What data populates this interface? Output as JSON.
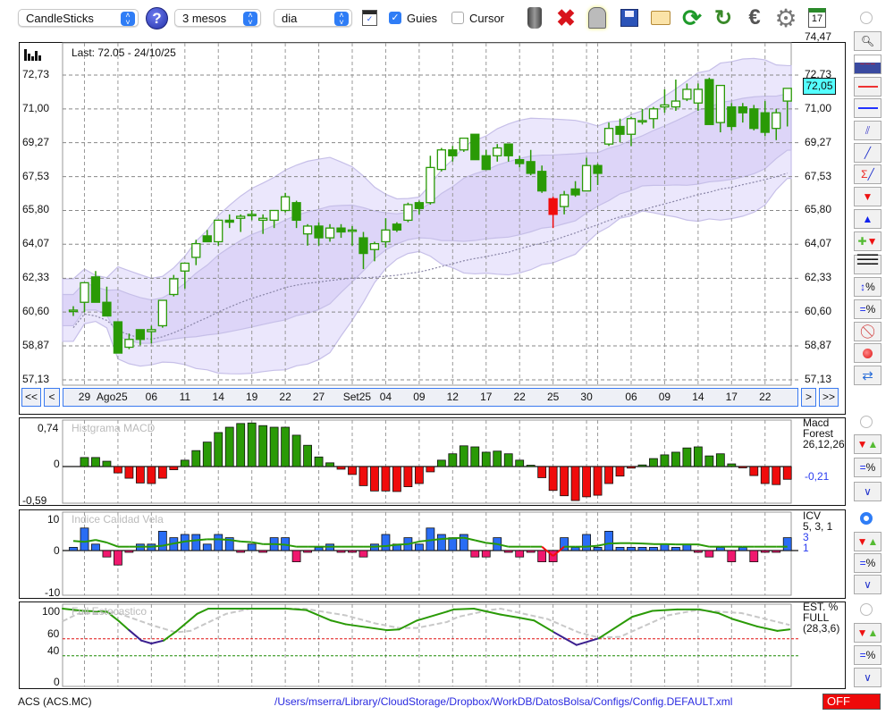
{
  "toolbar": {
    "chart_type": "CandleSticks",
    "period": "3 mesos",
    "interval": "dia",
    "guides_label": "Guies",
    "guides_checked": true,
    "cursor_label": "Cursor",
    "cursor_checked": false,
    "help": "?",
    "icons": [
      "trash-icon",
      "delete-icon",
      "lamp-icon",
      "save-icon",
      "folder-icon",
      "refresh-icon",
      "reload-icon",
      "euro-icon",
      "gear-icon",
      "calendar-icon"
    ],
    "calendar_day": "17"
  },
  "main_chart": {
    "last_label": "Last: 72.05 - 24/10/25",
    "current_price": "72,05",
    "y_labels": [
      "74,47",
      "72,73",
      "71,00",
      "69,27",
      "67,53",
      "65,80",
      "64,07",
      "62,33",
      "60,60",
      "58,87",
      "57,13"
    ],
    "y_values": [
      74.47,
      72.73,
      71.0,
      69.27,
      67.53,
      65.8,
      64.07,
      62.33,
      60.6,
      58.87,
      57.13
    ],
    "nav": {
      "first": "<<",
      "prev": "<",
      "next": ">",
      "last": ">>"
    },
    "x_labels": [
      {
        "t": "29",
        "i": 1
      },
      {
        "t": "Ago25",
        "i": 3.2
      },
      {
        "t": "06",
        "i": 7
      },
      {
        "t": "11",
        "i": 10
      },
      {
        "t": "14",
        "i": 13
      },
      {
        "t": "19",
        "i": 16
      },
      {
        "t": "22",
        "i": 19
      },
      {
        "t": "27",
        "i": 22
      },
      {
        "t": "Set25",
        "i": 25.3
      },
      {
        "t": "04",
        "i": 28
      },
      {
        "t": "09",
        "i": 31
      },
      {
        "t": "12",
        "i": 34
      },
      {
        "t": "17",
        "i": 37
      },
      {
        "t": "22",
        "i": 40
      },
      {
        "t": "25",
        "i": 43
      },
      {
        "t": "30",
        "i": 46
      },
      {
        "t": "06",
        "i": 50
      },
      {
        "t": "09",
        "i": 53
      },
      {
        "t": "14",
        "i": 56
      },
      {
        "t": "17",
        "i": 59
      },
      {
        "t": "22",
        "i": 62
      }
    ],
    "grid_index": [
      1,
      4,
      7,
      10,
      13,
      16,
      19,
      22,
      25,
      28,
      31,
      34,
      37,
      40,
      43,
      46,
      47,
      50,
      53,
      56,
      59,
      62
    ]
  },
  "chart_data": [
    {
      "type": "candlestick",
      "title": "Last: 72.05 - 24/10/25",
      "ylim": [
        57.13,
        74.47
      ],
      "ohlc": [
        [
          60.7,
          60.9,
          60.4,
          60.7
        ],
        [
          61.1,
          62.1,
          60.6,
          62.1
        ],
        [
          62.4,
          62.7,
          61.1,
          61.1
        ],
        [
          61.1,
          61.9,
          60.4,
          60.4
        ],
        [
          60.1,
          60.1,
          58.5,
          58.5
        ],
        [
          58.8,
          59.5,
          58.7,
          59.2
        ],
        [
          59.7,
          59.7,
          58.9,
          59.2
        ],
        [
          59.6,
          59.9,
          59.0,
          59.7
        ],
        [
          59.9,
          61.2,
          59.8,
          61.2
        ],
        [
          61.5,
          62.5,
          61.4,
          62.3
        ],
        [
          62.7,
          63.1,
          61.8,
          63.1
        ],
        [
          63.4,
          64.3,
          63.0,
          64.1
        ],
        [
          64.5,
          64.8,
          64.2,
          64.2
        ],
        [
          64.2,
          65.3,
          64.0,
          65.3
        ],
        [
          65.3,
          65.6,
          64.9,
          65.2
        ],
        [
          65.4,
          65.6,
          64.7,
          65.5
        ],
        [
          65.6,
          65.8,
          65.3,
          65.6
        ],
        [
          65.3,
          65.6,
          64.6,
          65.4
        ],
        [
          65.3,
          65.8,
          64.9,
          65.8
        ],
        [
          65.8,
          66.7,
          65.7,
          66.5
        ],
        [
          66.2,
          66.3,
          64.9,
          65.3
        ],
        [
          64.6,
          65.1,
          64.0,
          65.0
        ],
        [
          65.0,
          65.2,
          64.0,
          64.4
        ],
        [
          64.4,
          65.1,
          64.2,
          64.9
        ],
        [
          64.9,
          65.1,
          64.4,
          64.7
        ],
        [
          64.8,
          65.0,
          64.0,
          64.8
        ],
        [
          64.4,
          64.7,
          62.8,
          63.6
        ],
        [
          63.8,
          64.2,
          63.2,
          64.1
        ],
        [
          64.2,
          65.4,
          63.9,
          64.8
        ],
        [
          65.1,
          65.2,
          64.7,
          64.8
        ],
        [
          65.3,
          66.2,
          65.2,
          66.1
        ],
        [
          66.2,
          66.3,
          65.6,
          65.9
        ],
        [
          66.2,
          68.6,
          66.1,
          68.0
        ],
        [
          67.9,
          69.0,
          67.8,
          68.9
        ],
        [
          68.9,
          69.1,
          68.3,
          68.6
        ],
        [
          68.9,
          69.5,
          68.8,
          69.5
        ],
        [
          69.7,
          69.7,
          68.4,
          68.4
        ],
        [
          68.6,
          68.9,
          67.9,
          67.9
        ],
        [
          68.6,
          69.2,
          68.3,
          69.0
        ],
        [
          69.2,
          69.2,
          68.3,
          68.6
        ],
        [
          68.4,
          68.6,
          68.0,
          68.2
        ],
        [
          68.3,
          68.9,
          67.6,
          67.7
        ],
        [
          67.8,
          68.1,
          66.7,
          66.8
        ],
        [
          66.4,
          66.5,
          64.9,
          65.6
        ],
        [
          66.0,
          66.8,
          65.6,
          66.6
        ],
        [
          66.9,
          67.3,
          66.5,
          66.6
        ],
        [
          66.8,
          68.5,
          66.8,
          68.1
        ],
        [
          68.1,
          68.2,
          67.1,
          67.7
        ],
        [
          69.2,
          70.3,
          69.1,
          70.0
        ],
        [
          70.1,
          70.5,
          69.3,
          69.7
        ],
        [
          69.7,
          70.6,
          69.1,
          70.5
        ],
        [
          70.4,
          71.0,
          70.2,
          70.4
        ],
        [
          70.5,
          71.1,
          70.0,
          71.0
        ],
        [
          71.1,
          72.0,
          70.8,
          71.2
        ],
        [
          71.1,
          72.5,
          70.9,
          71.4
        ],
        [
          71.5,
          72.3,
          71.4,
          72.0
        ],
        [
          71.3,
          72.3,
          70.9,
          72.0
        ],
        [
          72.5,
          72.6,
          70.2,
          70.2
        ],
        [
          70.3,
          72.2,
          69.8,
          72.2
        ],
        [
          71.1,
          71.3,
          69.9,
          70.1
        ],
        [
          71.1,
          71.3,
          70.3,
          70.8
        ],
        [
          71.0,
          71.2,
          69.9,
          70.0
        ],
        [
          70.8,
          71.4,
          69.6,
          69.8
        ],
        [
          70.0,
          71.0,
          69.4,
          70.8
        ],
        [
          71.4,
          72.05,
          70.1,
          72.05
        ]
      ],
      "highlight_red": [
        43
      ],
      "colors": {
        "candle": "#2a9a06",
        "highlight": "#f00c0c",
        "band_outer": "#ebe7fc",
        "band_inner": "#ddd5f8"
      }
    },
    {
      "type": "bar",
      "title": "Histgrama MACD",
      "ylim": [
        -0.59,
        0.74
      ],
      "y_labels": [
        "0,74",
        "0",
        "-0,59"
      ],
      "side_labels": [
        "Macd",
        "Forest",
        "26,12,26"
      ],
      "current_value": "-0,21",
      "values": [
        null,
        0.17,
        0.17,
        0.1,
        -0.12,
        -0.22,
        -0.31,
        -0.32,
        -0.22,
        -0.06,
        0.12,
        0.3,
        0.46,
        0.64,
        0.74,
        0.81,
        0.82,
        0.77,
        0.74,
        0.74,
        0.59,
        0.4,
        0.18,
        0.07,
        -0.05,
        -0.15,
        -0.36,
        -0.46,
        -0.46,
        -0.47,
        -0.38,
        -0.32,
        -0.1,
        0.12,
        0.24,
        0.39,
        0.37,
        0.27,
        0.29,
        0.24,
        0.12,
        0,
        -0.21,
        -0.45,
        -0.55,
        -0.64,
        -0.57,
        -0.54,
        -0.32,
        -0.18,
        -0.03,
        0.03,
        0.15,
        0.22,
        0.27,
        0.35,
        0.37,
        0.2,
        0.24,
        0.05,
        -0.02,
        -0.17,
        -0.32,
        -0.34,
        -0.24
      ],
      "colors": {
        "up": "#2a9a06",
        "down": "#f00c0c"
      }
    },
    {
      "type": "bar",
      "title": "Indice Calidad Vela",
      "ylim": [
        -10,
        10
      ],
      "y_labels": [
        "10",
        "0",
        "-10"
      ],
      "side_labels": [
        "ICV",
        "5, 3, 1"
      ],
      "side_values": [
        "3",
        "1"
      ],
      "values": [
        1,
        7,
        2,
        -2,
        -4.5,
        -0.5,
        2,
        2,
        6,
        4,
        5,
        5,
        2,
        5,
        4,
        -0.5,
        2,
        -0.5,
        4,
        4,
        -3.5,
        -0.5,
        1,
        2,
        -0.5,
        -0.5,
        -2,
        2,
        5,
        2,
        4,
        2,
        7,
        5,
        4,
        5,
        -2,
        -2,
        4,
        -0.5,
        -2,
        -0.5,
        -3.5,
        -3.5,
        4,
        1,
        5,
        1,
        6,
        1,
        1,
        1,
        1,
        2,
        1,
        2,
        -0.5,
        -2,
        1,
        -3.5,
        1,
        -3.5,
        -0.5,
        -0.5,
        4
      ],
      "line": [
        3.0,
        2.7,
        3.3,
        2.5,
        1.2,
        1.2,
        1.2,
        1.2,
        1.5,
        2.2,
        2.8,
        3.2,
        3.5,
        3.5,
        3.3,
        2.8,
        2.6,
        2.0,
        2.0,
        1.8,
        1.2,
        1.2,
        1.2,
        1.2,
        1.2,
        1.2,
        1.2,
        1.2,
        1.4,
        1.8,
        2.0,
        2.8,
        3.2,
        3.6,
        3.8,
        4.0,
        3.2,
        2.4,
        2.0,
        1.2,
        1.2,
        1.2,
        1.2,
        -1.7,
        1.2,
        1.2,
        1.2,
        1.5,
        2.2,
        2.3,
        2.3,
        2.2,
        2.0,
        2.0,
        1.9,
        1.9,
        1.9,
        1.2,
        1.2,
        1.2,
        1.2,
        1.2,
        1.2,
        1.2,
        1.2
      ],
      "colors": {
        "up": "#2a6df5",
        "down": "#f0186e",
        "line": "#2a9a06",
        "line_neg": "#f00c0c"
      }
    },
    {
      "type": "line",
      "title": "Full Estocastico",
      "ylim": [
        0,
        100
      ],
      "y_labels": [
        "100",
        "60",
        "40",
        "0"
      ],
      "levels": [
        60,
        40
      ],
      "side_labels": [
        "EST. %",
        "FULL",
        "(28,3,6)"
      ],
      "k": [
        [
          -1,
          100
        ],
        [
          0.9,
          97
        ],
        [
          3,
          96
        ],
        [
          4.1,
          83
        ],
        [
          5,
          71
        ],
        [
          6.1,
          57
        ],
        [
          7,
          53
        ],
        [
          8.1,
          57
        ],
        [
          9.2,
          69
        ],
        [
          11.1,
          93
        ],
        [
          12.1,
          100
        ],
        [
          19.1,
          100
        ],
        [
          20.9,
          98
        ],
        [
          23.1,
          84
        ],
        [
          24.4,
          79
        ],
        [
          28.1,
          71
        ],
        [
          29.2,
          72
        ],
        [
          30.8,
          84
        ],
        [
          33.5,
          96
        ],
        [
          34.1,
          99
        ],
        [
          35.9,
          100
        ],
        [
          38.3,
          92
        ],
        [
          39.9,
          88
        ],
        [
          41.3,
          84
        ],
        [
          43.1,
          68
        ],
        [
          45.1,
          51
        ],
        [
          47.1,
          60
        ],
        [
          50.1,
          89
        ],
        [
          51.9,
          97
        ],
        [
          54.1,
          99
        ],
        [
          56.1,
          99
        ],
        [
          57.8,
          94
        ],
        [
          59.1,
          86
        ],
        [
          61.3,
          76
        ],
        [
          63.1,
          70
        ],
        [
          64.2,
          72
        ]
      ],
      "d": [
        [
          -1,
          83
        ],
        [
          0.4,
          93
        ],
        [
          3.8,
          95
        ],
        [
          7,
          78
        ],
        [
          9.2,
          68
        ],
        [
          10.5,
          70
        ],
        [
          13.7,
          93
        ],
        [
          15.9,
          100
        ],
        [
          20.7,
          100
        ],
        [
          24.4,
          91
        ],
        [
          27.1,
          80
        ],
        [
          29.2,
          74
        ],
        [
          30.8,
          74
        ],
        [
          33.5,
          82
        ],
        [
          34.5,
          89
        ],
        [
          37.3,
          98
        ],
        [
          38.3,
          100
        ],
        [
          42.5,
          86
        ],
        [
          45.3,
          68
        ],
        [
          47.1,
          61
        ],
        [
          49,
          62
        ],
        [
          53.3,
          91
        ],
        [
          55.9,
          98
        ],
        [
          59.9,
          94
        ],
        [
          64.2,
          78
        ]
      ],
      "highlight_ranges": [
        [
          5,
          8.1
        ],
        [
          43.1,
          47.1
        ]
      ],
      "colors": {
        "k": "#2a9a06",
        "k_low": "#3b1f8f",
        "d": "#c8c8c8",
        "level60": "#e01010",
        "level40": "#1a8a00"
      }
    }
  ],
  "status": {
    "symbol": "ACS (ACS.MC)",
    "config_path": "/Users/mserra/Library/CloudStorage/Dropbox/WorkDB/DatosBolsa/Configs/Config.DEFAULT.xml",
    "mode": "OFF"
  }
}
